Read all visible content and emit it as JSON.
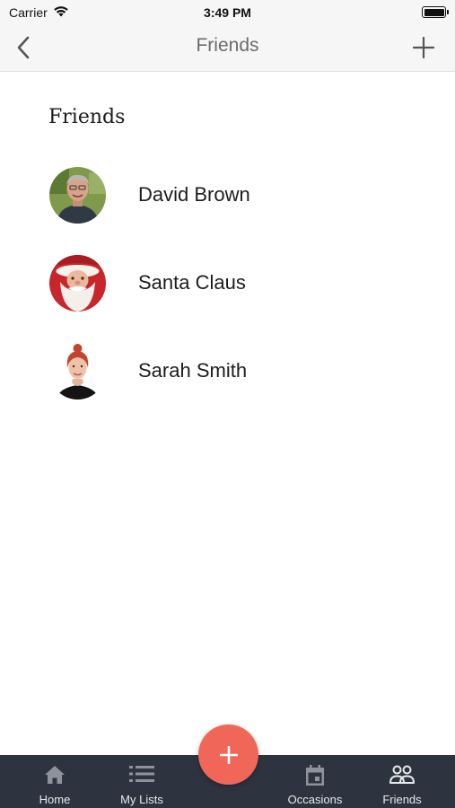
{
  "status_bar": {
    "carrier": "Carrier",
    "time": "3:49 PM",
    "icons": [
      "wifi-icon",
      "battery-icon"
    ]
  },
  "nav_bar": {
    "title": "Friends",
    "back_icon": "chevron-left-icon",
    "add_icon": "plus-icon"
  },
  "section": {
    "heading": "Friends"
  },
  "friends": [
    {
      "name": "David Brown",
      "avatar_icon": "avatar-david-brown"
    },
    {
      "name": "Santa Claus",
      "avatar_icon": "avatar-santa-claus"
    },
    {
      "name": "Sarah Smith",
      "avatar_icon": "avatar-sarah-smith"
    }
  ],
  "tab_bar": {
    "tabs": [
      {
        "label": "Home",
        "icon": "home-icon"
      },
      {
        "label": "My Lists",
        "icon": "list-icon"
      },
      {
        "label": "Occasions",
        "icon": "calendar-icon"
      },
      {
        "label": "Friends",
        "icon": "friends-icon"
      }
    ],
    "fab_icon": "plus-icon"
  },
  "colors": {
    "accent": "#f0675a",
    "tab_bar_background": "#2d3440",
    "nav_background": "#f6f6f6",
    "nav_title": "#6b6b6b"
  }
}
